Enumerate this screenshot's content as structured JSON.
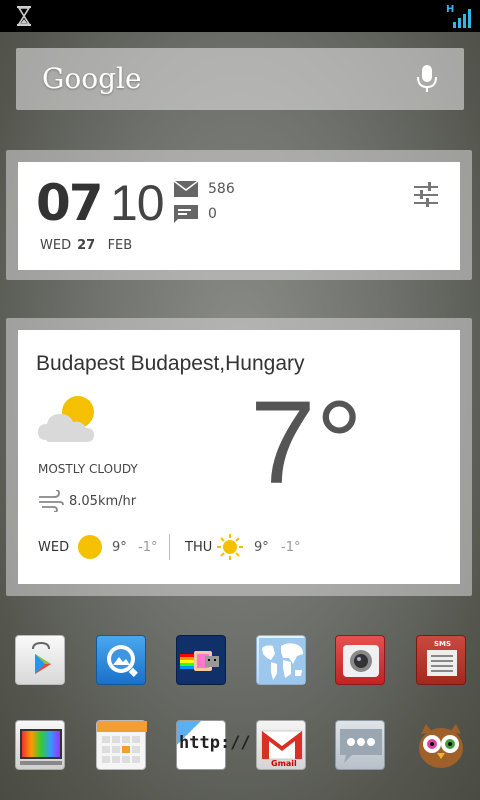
{
  "status_bar": {
    "left_icon": "hourglass-icon",
    "network_type": "H",
    "signal_icon": "signal-bars-icon"
  },
  "search": {
    "logo": "Google",
    "mic_icon": "microphone-icon"
  },
  "clock_widget": {
    "hour": "07",
    "minute": "10",
    "day_name": "WED",
    "day_number": "27",
    "month": "FEB",
    "mail_count": "586",
    "sms_count": "0"
  },
  "weather_widget": {
    "location": "Budapest Budapest,Hungary",
    "condition": "MOSTLY CLOUDY",
    "wind": "8.05km/hr",
    "temperature": "7°",
    "forecast": [
      {
        "day": "WED",
        "high": "9°",
        "low": "-1°"
      },
      {
        "day": "THU",
        "high": "9°",
        "low": "-1°"
      }
    ]
  },
  "dock": {
    "row1": [
      "play-store-icon",
      "qq-icon",
      "nyan-cat-icon",
      "world-map-icon",
      "camera-icon",
      "sms-app-icon"
    ],
    "row2": [
      "samsung-tv-icon",
      "calendar-icon",
      "browser-icon",
      "gmail-icon",
      "messaging-icon",
      "owl-icon"
    ],
    "gmail_label": "Gmail",
    "sms_label": "SMS",
    "http_label": "http://"
  },
  "colors": {
    "accent_blue": "#33b5e5",
    "sun_yellow": "#f5c000"
  }
}
